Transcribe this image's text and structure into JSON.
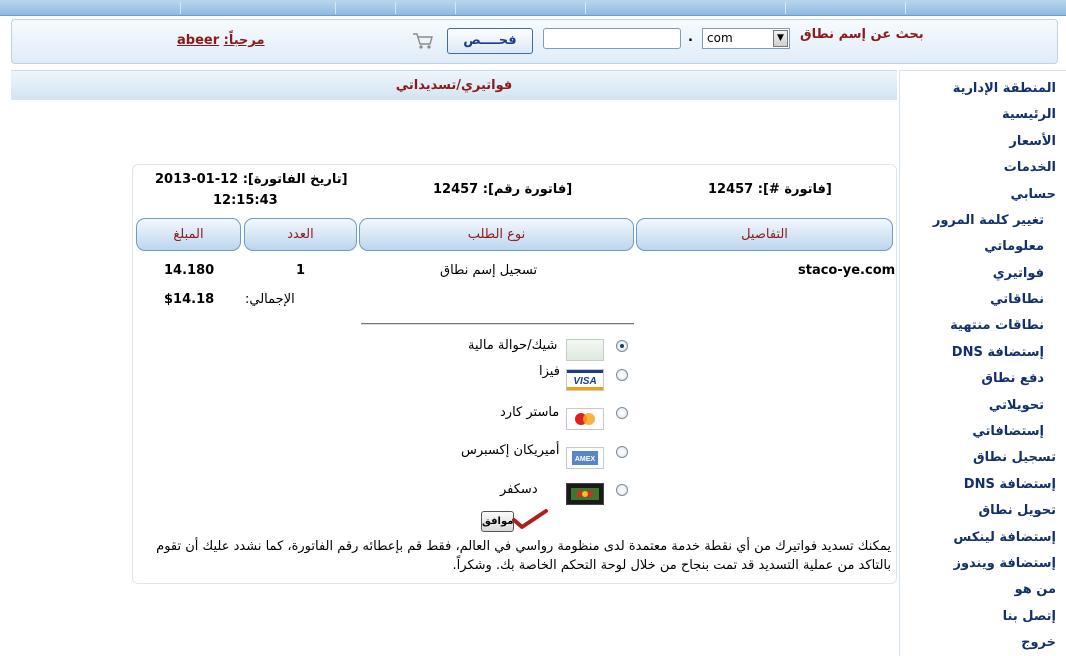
{
  "header": {
    "search_label": "بحث عن إسم نطاق",
    "tld_value": "com",
    "dot": ".",
    "domain_input_value": "",
    "check_button": "فحــــص",
    "welcome_prefix": "مرحباً:",
    "username": "abeer"
  },
  "page": {
    "title": "فواتيري/تسديداتي"
  },
  "sidebar": {
    "items": [
      {
        "label": "المنطقة الإدارية"
      },
      {
        "label": "الرئيسية"
      },
      {
        "label": "الأسعار"
      },
      {
        "label": "الخدمات"
      },
      {
        "label": "حسابي"
      },
      {
        "label": "تغيير كلمة المرور"
      },
      {
        "label": "معلوماتي"
      },
      {
        "label": "فواتيري"
      },
      {
        "label": "نطاقاتي"
      },
      {
        "label": "نطاقات منتهية"
      },
      {
        "label": "إستضافة DNS"
      },
      {
        "label": "دفع نطاق"
      },
      {
        "label": "تحويلاتي"
      },
      {
        "label": "إستضافاتي"
      },
      {
        "label": "تسجيل نطاق"
      },
      {
        "label": "إستضافة DNS"
      },
      {
        "label": "تحويل نطاق"
      },
      {
        "label": "إستضافة لينكس"
      },
      {
        "label": "إستضافة ويندوز"
      },
      {
        "label": "من هو"
      },
      {
        "label": "إتصل بنا"
      },
      {
        "label": "خروج"
      }
    ]
  },
  "invoice": {
    "invoice_no_label": "[فاتورة #]:",
    "invoice_no": "12457",
    "invoice_num_label": "[فاتورة رقم]:",
    "invoice_num": "12457",
    "date_label": "[تاريخ الفاتورة]:",
    "date": "12-01-2013",
    "time": "12:15:43",
    "columns": {
      "details": "التفاصيل",
      "order_type": "نوع الطلب",
      "count": "العدد",
      "amount": "المبلغ"
    },
    "row": {
      "details": "staco-ye.com",
      "order_type": "تسجيل إسم نطاق",
      "count": "1",
      "amount": "14.180"
    },
    "total_label": "الإجمالي:",
    "total_value": "$14.18"
  },
  "payment": {
    "options": [
      {
        "label": "شيك/حوالة مالية",
        "icon": "cheque-icon",
        "selected": true
      },
      {
        "label": "فيزا",
        "icon": "visa-icon",
        "selected": false
      },
      {
        "label": "ماستر كارد",
        "icon": "mastercard-icon",
        "selected": false
      },
      {
        "label": "أميريكان إكسبرس",
        "icon": "amex-icon",
        "selected": false
      },
      {
        "label": "دسكفر",
        "icon": "discover-icon",
        "selected": false
      }
    ],
    "ok_button": "موافق",
    "note": "يمكنك تسديد فواتيرك من أي نقطة خدمة معتمدة لدى منظومة رواسي في العالم، فقط قم بإعطائه رقم الفاتورة، كما نشدد عليك أن تقوم بالتاكد من عملية التسديد قد تمت بنجاح من خلال لوحة التحكم الخاصة بك. وشكراً."
  },
  "colors": {
    "accent_red": "#8b1a1a",
    "menu_blue": "#13306b",
    "header_blue": "#8fb9df"
  }
}
